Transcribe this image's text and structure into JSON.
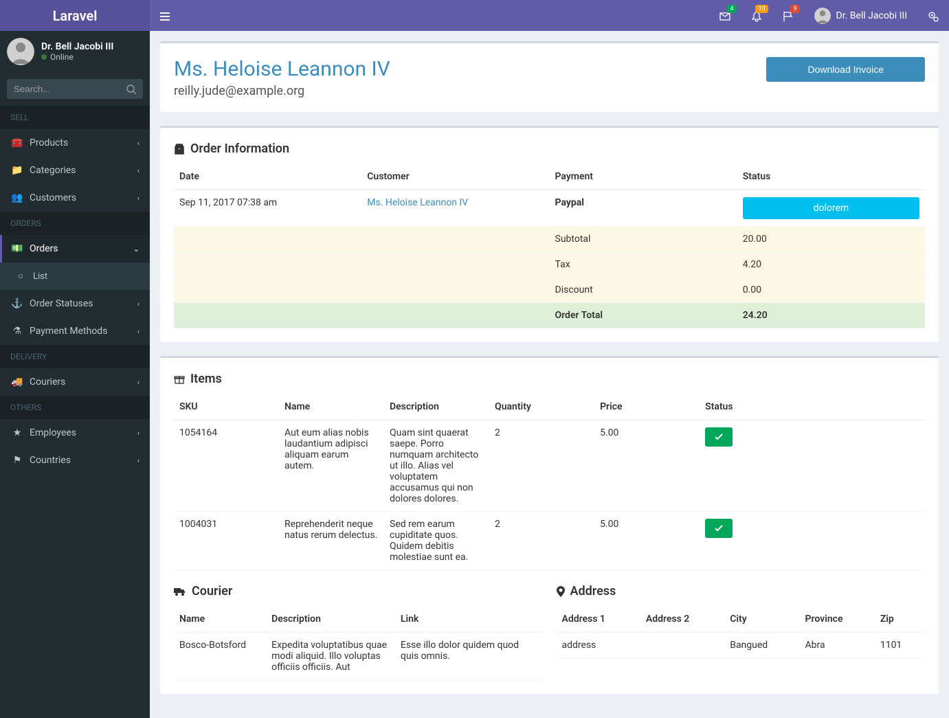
{
  "brand": "Laravel",
  "header": {
    "badges": {
      "mail": "4",
      "bell": "10",
      "comment": "9"
    },
    "user": "Dr. Bell Jacobi III"
  },
  "sidebar": {
    "user": {
      "name": "Dr. Bell Jacobi III",
      "status": "Online"
    },
    "searchPlaceholder": "Search...",
    "sections": {
      "sell": "SELL",
      "orders": "ORDERS",
      "delivery": "DELIVERY",
      "others": "OTHERS"
    },
    "items": {
      "products": "Products",
      "categories": "Categories",
      "customers": "Customers",
      "ordersItem": "Orders",
      "ordersList": "List",
      "orderStatuses": "Order Statuses",
      "paymentMethods": "Payment Methods",
      "couriers": "Couriers",
      "employees": "Employees",
      "countries": "Countries"
    }
  },
  "customer": {
    "name": "Ms. Heloise Leannon IV",
    "email": "reilly.jude@example.org"
  },
  "buttons": {
    "downloadInvoice": "Download Invoice"
  },
  "orderInfo": {
    "title": "Order Information",
    "headers": {
      "date": "Date",
      "customer": "Customer",
      "payment": "Payment",
      "status": "Status"
    },
    "row": {
      "date": "Sep 11, 2017 07:38 am",
      "customer": "Ms. Heloise Leannon IV",
      "payment": "Paypal",
      "status": "dolorem"
    },
    "totals": [
      {
        "label": "Subtotal",
        "value": "20.00",
        "class": "row-warning"
      },
      {
        "label": "Tax",
        "value": "4.20",
        "class": "row-warning"
      },
      {
        "label": "Discount",
        "value": "0.00",
        "class": "row-warning"
      },
      {
        "label": "Order Total",
        "value": "24.20",
        "class": "row-success"
      }
    ]
  },
  "items": {
    "title": "Items",
    "headers": {
      "sku": "SKU",
      "name": "Name",
      "description": "Description",
      "quantity": "Quantity",
      "price": "Price",
      "status": "Status"
    },
    "rows": [
      {
        "sku": "1054164",
        "name": "Aut eum alias nobis laudantium adipisci aliquam earum autem.",
        "description": "Quam sint quaerat saepe. Porro numquam architecto ut illo. Alias vel voluptatem accusamus qui non dolores dolores.",
        "quantity": "2",
        "price": "5.00"
      },
      {
        "sku": "1004031",
        "name": "Reprehenderit neque natus rerum delectus.",
        "description": "Sed rem earum cupiditate quos. Quidem debitis molestiae sunt ea.",
        "quantity": "2",
        "price": "5.00"
      }
    ]
  },
  "courier": {
    "title": "Courier",
    "headers": {
      "name": "Name",
      "description": "Description",
      "link": "Link"
    },
    "row": {
      "name": "Bosco-Botsford",
      "description": "Expedita voluptatibus quae modi aliquid. Illo voluptas officiis officiis. Aut",
      "link": "Esse illo dolor quidem quod quis omnis."
    }
  },
  "address": {
    "title": "Address",
    "headers": {
      "a1": "Address 1",
      "a2": "Address 2",
      "city": "City",
      "province": "Province",
      "zip": "Zip"
    },
    "row": {
      "a1": "address",
      "a2": "",
      "city": "Bangued",
      "province": "Abra",
      "zip": "1101"
    }
  }
}
